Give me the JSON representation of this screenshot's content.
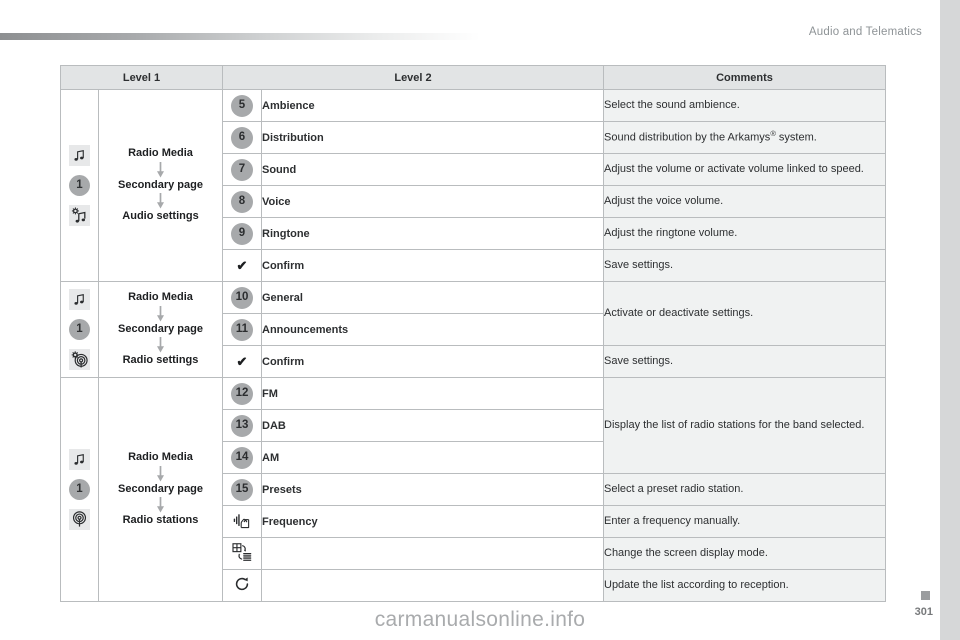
{
  "header": {
    "title": "Audio and Telematics"
  },
  "footer": {
    "watermark": "carmanualsonline.info",
    "page_number": "301"
  },
  "table": {
    "columns": [
      "Level 1",
      "Level 2",
      "Comments"
    ],
    "groups": [
      {
        "id": "audio-settings",
        "icons": [
          "music-note-icon",
          "number-1-badge",
          "music-note-settings-icon"
        ],
        "path": [
          "Radio Media",
          "Secondary page",
          "Audio settings"
        ],
        "rows": [
          {
            "badge": "5",
            "badge_type": "number",
            "label": "Ambience",
            "comment": "Select the sound ambience."
          },
          {
            "badge": "6",
            "badge_type": "number",
            "label": "Distribution",
            "comment": "Sound distribution by the Arkamys® system.",
            "comment_sup": true
          },
          {
            "badge": "7",
            "badge_type": "number",
            "label": "Sound",
            "comment": "Adjust the volume or activate volume linked to speed."
          },
          {
            "badge": "8",
            "badge_type": "number",
            "label": "Voice",
            "comment": "Adjust the voice volume."
          },
          {
            "badge": "9",
            "badge_type": "number",
            "label": "Ringtone",
            "comment": "Adjust the ringtone volume."
          },
          {
            "badge": "✔",
            "badge_type": "check",
            "label": "Confirm",
            "comment": "Save settings."
          }
        ]
      },
      {
        "id": "radio-settings",
        "icons": [
          "music-note-icon",
          "number-1-badge",
          "radio-settings-icon"
        ],
        "path": [
          "Radio Media",
          "Secondary page",
          "Radio settings"
        ],
        "rows": [
          {
            "badge": "10",
            "badge_type": "number",
            "label": "General",
            "comment": "Activate or deactivate settings.",
            "comment_rowspan": 2
          },
          {
            "badge": "11",
            "badge_type": "number",
            "label": "Announcements",
            "comment": ""
          },
          {
            "badge": "✔",
            "badge_type": "check",
            "label": "Confirm",
            "comment": "Save settings."
          }
        ]
      },
      {
        "id": "radio-stations",
        "icons": [
          "music-note-icon",
          "number-1-badge",
          "radio-antenna-icon"
        ],
        "path": [
          "Radio Media",
          "Secondary page",
          "Radio stations"
        ],
        "rows": [
          {
            "badge": "12",
            "badge_type": "number",
            "label": "FM",
            "comment": "Display the list of radio stations for the band selected.",
            "comment_rowspan": 3
          },
          {
            "badge": "13",
            "badge_type": "number",
            "label": "DAB",
            "comment": ""
          },
          {
            "badge": "14",
            "badge_type": "number",
            "label": "AM",
            "comment": ""
          },
          {
            "badge": "15",
            "badge_type": "number",
            "label": "Presets",
            "comment": "Select a preset radio station."
          },
          {
            "badge": "frequency-hand-icon",
            "badge_type": "icon",
            "label": "Frequency",
            "comment": "Enter a frequency manually."
          },
          {
            "badge": "display-mode-icon",
            "badge_type": "icon",
            "label": "",
            "comment": "Change the screen display mode."
          },
          {
            "badge": "refresh-icon",
            "badge_type": "icon",
            "label": "",
            "comment": "Update the list according to reception."
          }
        ]
      }
    ]
  },
  "colors": {
    "badge_grey": "#a7a9ab",
    "header_grey": "#e2e4e5",
    "comment_bg": "#f0f2f2",
    "border": "#b9bcbe",
    "title_grey": "#8e9396"
  }
}
